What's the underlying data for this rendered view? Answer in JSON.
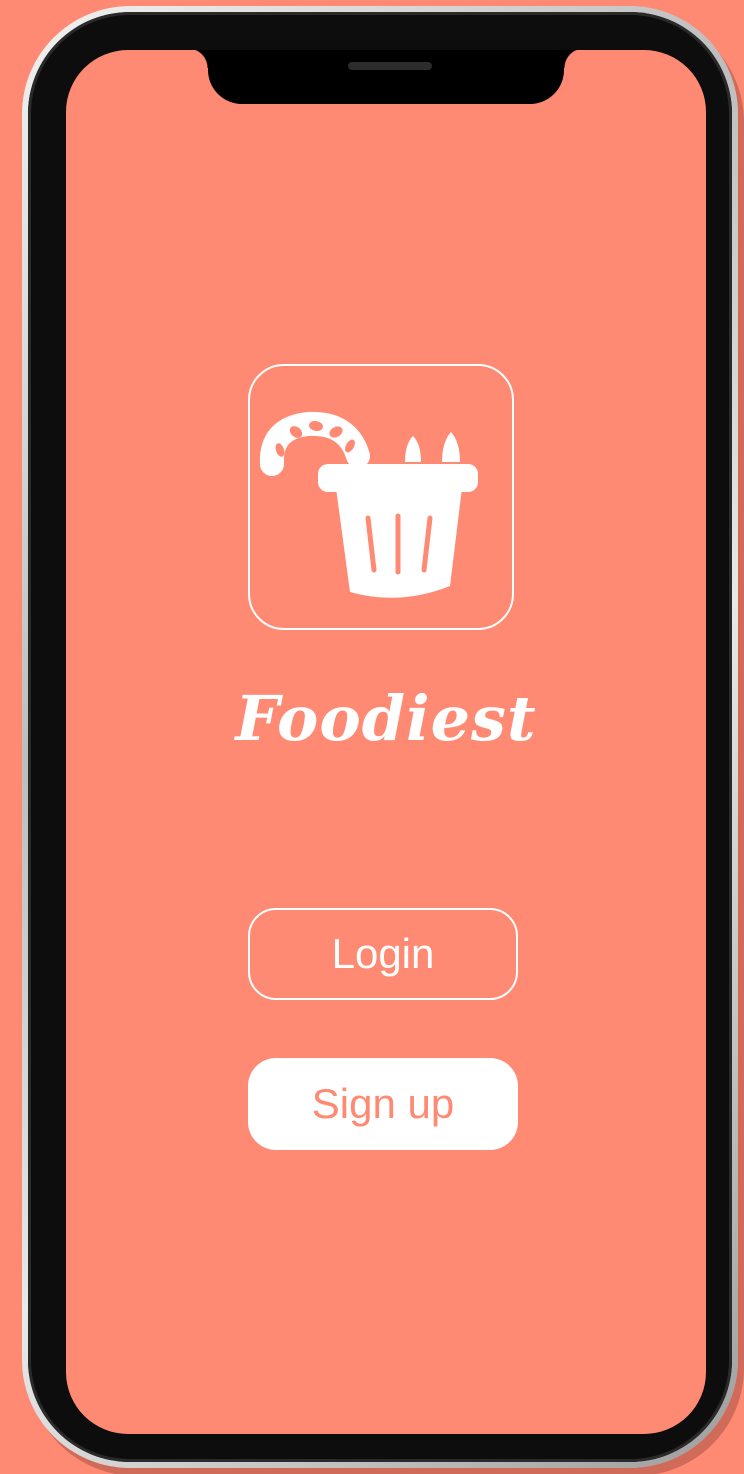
{
  "app": {
    "name": "Foodiest"
  },
  "logo": {
    "icon": "food-bucket-icon"
  },
  "actions": {
    "login_label": "Login",
    "signup_label": "Sign up"
  },
  "colors": {
    "background": "#ff8a74",
    "foreground": "#ffffff"
  }
}
